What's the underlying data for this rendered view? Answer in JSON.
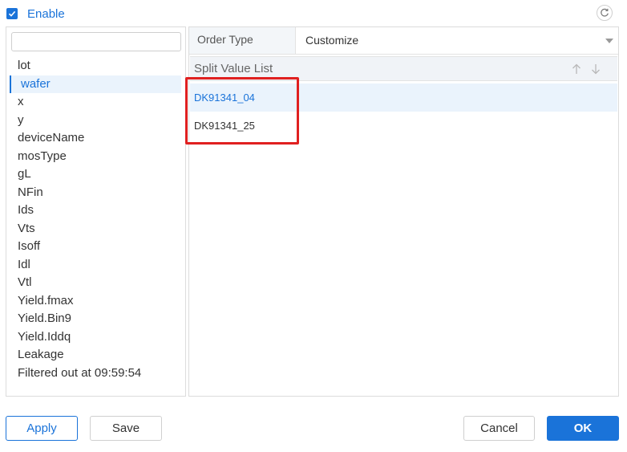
{
  "enable": {
    "label": "Enable",
    "checked": true
  },
  "colors": {
    "accent": "#1a73d9",
    "highlight": "#e02020"
  },
  "search": {
    "value": "",
    "placeholder": ""
  },
  "fields": [
    {
      "label": "lot",
      "selected": false
    },
    {
      "label": "wafer",
      "selected": true
    },
    {
      "label": "x",
      "selected": false
    },
    {
      "label": "y",
      "selected": false
    },
    {
      "label": "deviceName",
      "selected": false
    },
    {
      "label": "mosType",
      "selected": false
    },
    {
      "label": "gL",
      "selected": false
    },
    {
      "label": "NFin",
      "selected": false
    },
    {
      "label": "Ids",
      "selected": false
    },
    {
      "label": "Vts",
      "selected": false
    },
    {
      "label": "Isoff",
      "selected": false
    },
    {
      "label": "Idl",
      "selected": false
    },
    {
      "label": "Vtl",
      "selected": false
    },
    {
      "label": "Yield.fmax",
      "selected": false
    },
    {
      "label": "Yield.Bin9",
      "selected": false
    },
    {
      "label": "Yield.Iddq",
      "selected": false
    },
    {
      "label": "Leakage",
      "selected": false
    },
    {
      "label": "Filtered out at 09:59:54",
      "selected": false
    }
  ],
  "order": {
    "label": "Order Type",
    "value": "Customize"
  },
  "split": {
    "title": "Split Value List",
    "values": [
      {
        "label": "DK91341_04",
        "selected": true
      },
      {
        "label": "DK91341_25",
        "selected": false
      }
    ]
  },
  "buttons": {
    "apply": "Apply",
    "save": "Save",
    "cancel": "Cancel",
    "ok": "OK"
  },
  "icons": {
    "refresh": "refresh-icon",
    "up": "arrow-up-icon",
    "down": "arrow-down-icon",
    "check": "check-icon"
  }
}
